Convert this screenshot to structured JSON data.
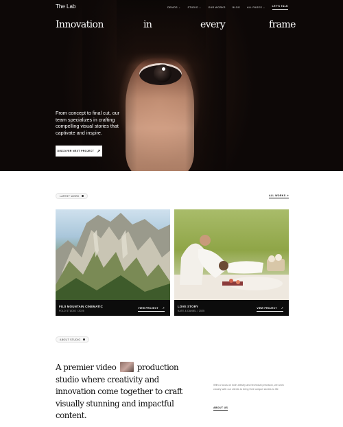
{
  "nav": {
    "brand": "The Lab",
    "items": [
      "DEMOS",
      "STUDIO",
      "OUR WORKS",
      "BLOG",
      "ALL PAGES"
    ],
    "cta": "LET'S TALK"
  },
  "hero": {
    "headline": [
      "Innovation",
      "in",
      "every",
      "frame"
    ],
    "text": "From concept to final cut, our team specializes in crafting compelling visual stories that captivate and inspire.",
    "button": "DISCOVER NEXT PROJECT"
  },
  "works": {
    "section_label": "LATEST WORK",
    "all_link": "ALL WORKS",
    "items": [
      {
        "title": "FUJI MOUNTAIN CINEMATIC",
        "sub": "FOLD STUDIO / 2025",
        "action": "VIEW PROJECT"
      },
      {
        "title": "LOVE STORY",
        "sub": "KATE & DANIEL / 2025",
        "action": "VIEW PROJECT"
      }
    ]
  },
  "about": {
    "section_label": "ABOUT STUDIO",
    "statement_a": "A premier video",
    "statement_b": "production studio where creativity and innovation come together to craft visually stunning and impactful content.",
    "side_text": "With a focus on both artistry and technical precision, we work closely with our clients to bring their unique stories to life",
    "link": "ABOUT US"
  },
  "colors": {
    "hero_bg": "#0d0807",
    "text": "#111111",
    "accent": "#ffffff"
  }
}
